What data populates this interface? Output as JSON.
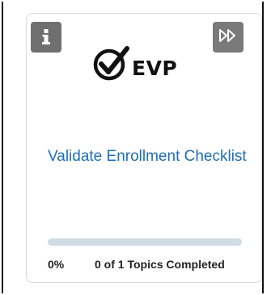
{
  "card": {
    "logo_text": "EVP",
    "title": "Validate Enrollment Checklist",
    "progress_percent": 0,
    "percent_label": "0%",
    "topics_label": "0 of 1 Topics Completed",
    "info_icon": "info-icon",
    "skip_icon": "skip-forward-icon",
    "logo_icon": "checkmark-circle-icon"
  },
  "colors": {
    "accent": "#1f6fb5",
    "button_bg": "#6f6f6f",
    "track": "#d0dbe5"
  }
}
